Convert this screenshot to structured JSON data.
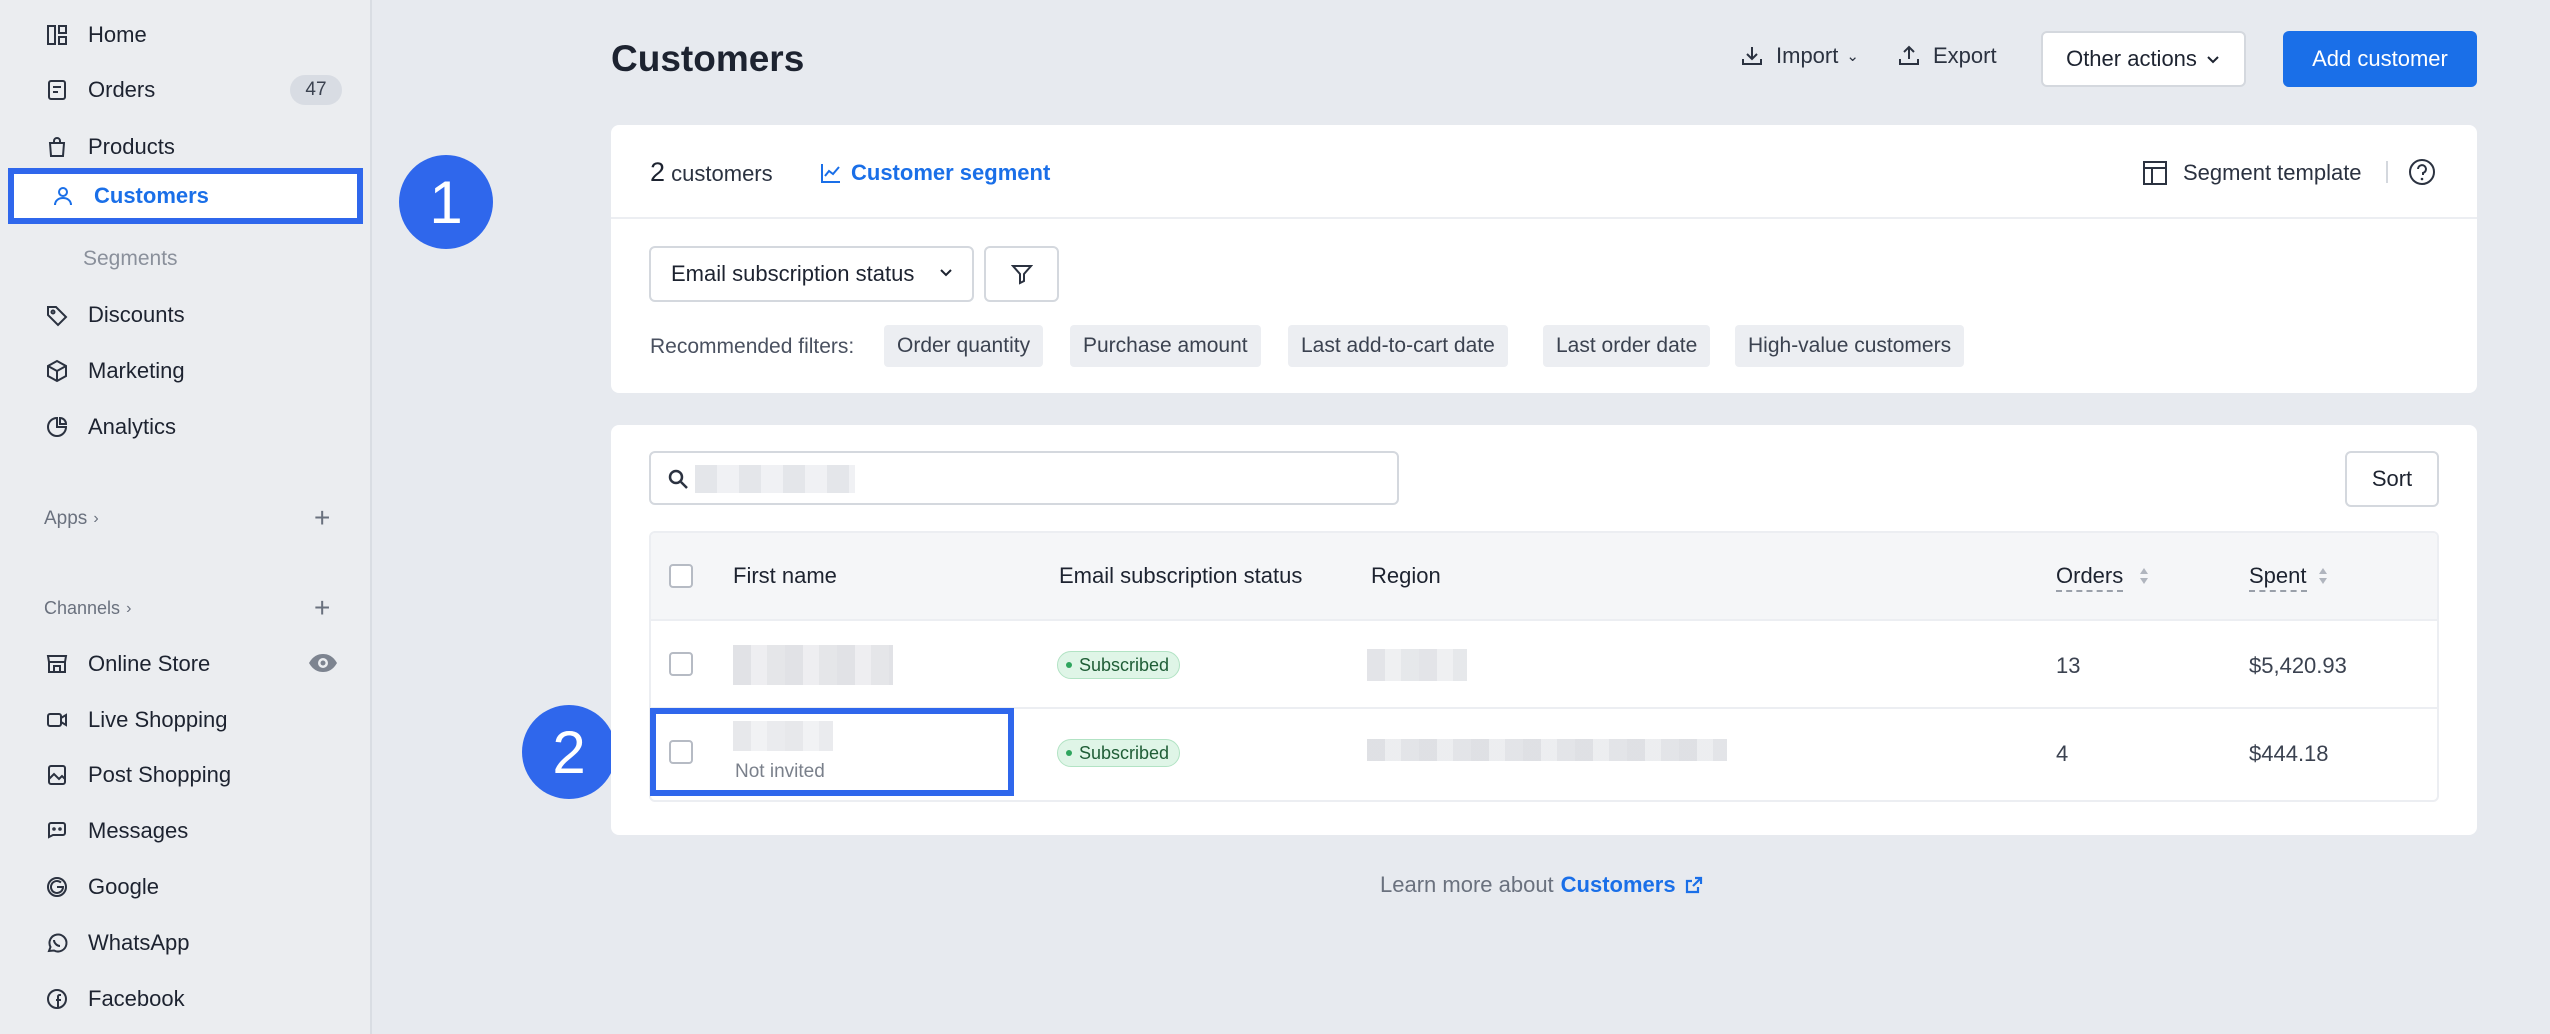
{
  "sidebar": {
    "items": [
      {
        "label": "Home",
        "icon": "home-icon"
      },
      {
        "label": "Orders",
        "icon": "orders-icon",
        "badge": "47"
      },
      {
        "label": "Products",
        "icon": "bag-icon"
      },
      {
        "label": "Customers",
        "icon": "person-icon",
        "active": true
      },
      {
        "label": "Discounts",
        "icon": "tag-icon"
      },
      {
        "label": "Marketing",
        "icon": "cube-icon"
      },
      {
        "label": "Analytics",
        "icon": "pie-chart-icon"
      }
    ],
    "sub_segments": "Segments",
    "apps_label": "Apps",
    "channels_label": "Channels",
    "channels": [
      {
        "label": "Online Store",
        "icon": "store-icon"
      },
      {
        "label": "Live Shopping",
        "icon": "video-icon"
      },
      {
        "label": "Post Shopping",
        "icon": "image-post-icon"
      },
      {
        "label": "Messages",
        "icon": "chat-icon"
      },
      {
        "label": "Google",
        "icon": "google-icon"
      },
      {
        "label": "WhatsApp",
        "icon": "whatsapp-icon"
      },
      {
        "label": "Facebook",
        "icon": "facebook-icon"
      }
    ]
  },
  "markers": {
    "one": "1",
    "two": "2"
  },
  "header": {
    "title": "Customers",
    "import_label": "Import",
    "export_label": "Export",
    "other_actions_label": "Other actions",
    "add_customer_label": "Add customer"
  },
  "segment_card": {
    "count": "2",
    "count_suffix": "customers",
    "segment_link": "Customer segment",
    "segment_template": "Segment template",
    "filter_select": "Email subscription status",
    "recommended_label": "Recommended filters:",
    "chips": [
      "Order quantity",
      "Purchase amount",
      "Last add-to-cart date",
      "Last order date",
      "High-value customers"
    ]
  },
  "table": {
    "sort_label": "Sort",
    "columns": {
      "first_name": "First name",
      "email_status": "Email subscription status",
      "region": "Region",
      "orders": "Orders",
      "spent": "Spent"
    },
    "rows": [
      {
        "status": "Subscribed",
        "orders": "13",
        "spent": "$5,420.93",
        "note": ""
      },
      {
        "status": "Subscribed",
        "orders": "4",
        "spent": "$444.18",
        "note": "Not invited"
      }
    ]
  },
  "footer": {
    "text": "Learn more about",
    "link": "Customers"
  },
  "colors": {
    "accent": "#1a6fe8",
    "marker": "#2f67ec",
    "subscribed_bg": "#dff5e7"
  }
}
